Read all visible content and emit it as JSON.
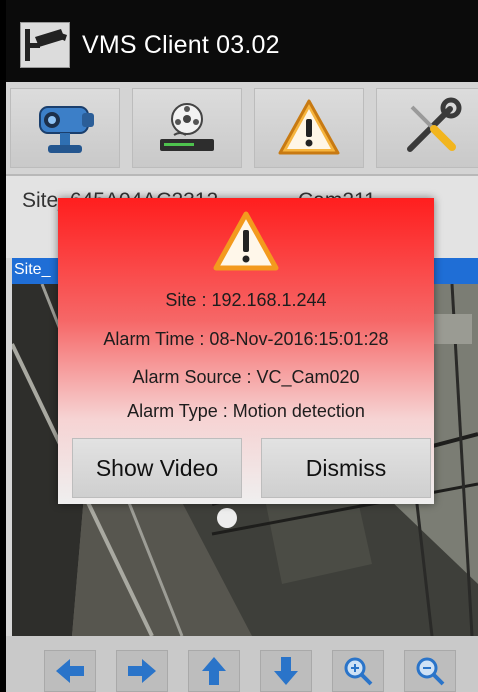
{
  "app": {
    "title": "VMS Client 03.02"
  },
  "toolbar": {
    "buttons": [
      {
        "icon": "camera-icon"
      },
      {
        "icon": "recorder-icon"
      },
      {
        "icon": "warning-icon"
      },
      {
        "icon": "tools-icon"
      }
    ]
  },
  "info": {
    "site_name": "Site_645A04AC2312",
    "cam_name": "Cam211"
  },
  "video": {
    "header_label": "Site_"
  },
  "alarm": {
    "site": "Site : 192.168.1.244",
    "time": "Alarm Time : 08-Nov-2016:15:01:28",
    "source": "Alarm Source : VC_Cam020",
    "type": "Alarm Type : Motion detection",
    "show_video_label": "Show Video",
    "dismiss_label": "Dismiss"
  },
  "ptz": {
    "buttons": [
      "left-arrow-icon",
      "right-arrow-icon",
      "up-arrow-icon",
      "down-arrow-icon",
      "zoom-in-icon",
      "zoom-out-icon"
    ]
  },
  "colors": {
    "alarm_red": "#ff1e1e",
    "selection_blue": "#1f6ed6",
    "arrow_blue": "#2a74c9"
  }
}
